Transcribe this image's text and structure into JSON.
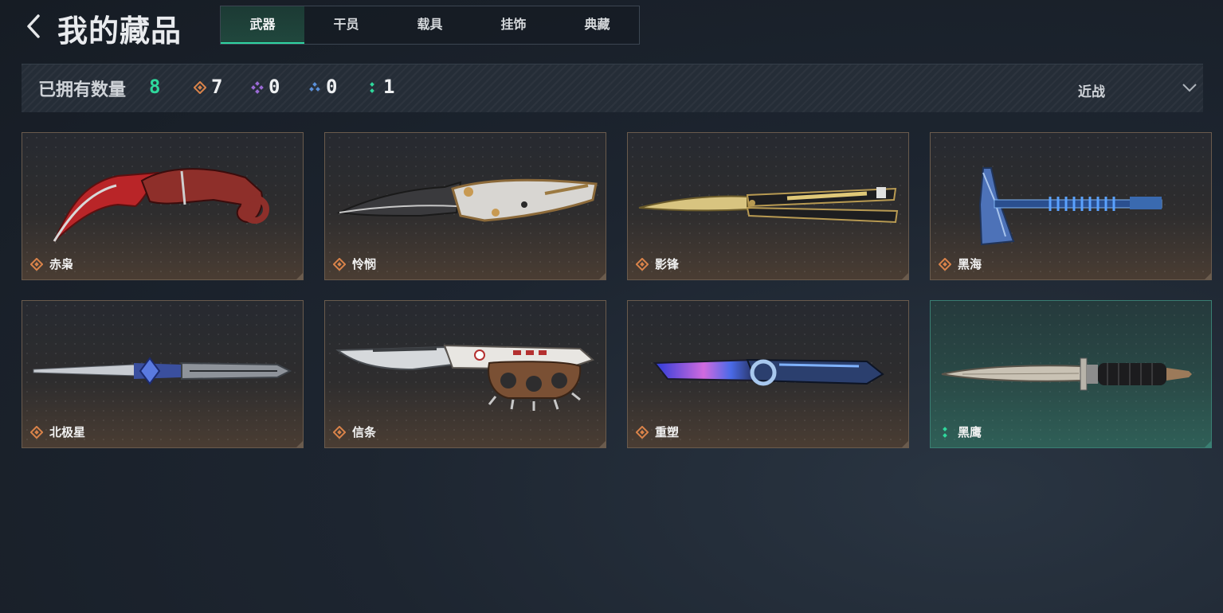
{
  "header": {
    "title": "我的藏品",
    "tabs": [
      {
        "label": "武器",
        "active": true
      },
      {
        "label": "干员",
        "active": false
      },
      {
        "label": "载具",
        "active": false
      },
      {
        "label": "挂饰",
        "active": false
      },
      {
        "label": "典藏",
        "active": false
      }
    ]
  },
  "summary": {
    "owned_label": "已拥有数量",
    "owned_count": "8",
    "rarity_counts": [
      {
        "icon": "orange-diamond-icon",
        "color": "#d9834a",
        "value": "7"
      },
      {
        "icon": "purple-diamond-icon",
        "color": "#9b6bd6",
        "value": "0"
      },
      {
        "icon": "blue-triangle-icon",
        "color": "#5b8fd8",
        "value": "0"
      },
      {
        "icon": "green-dots-icon",
        "color": "#2fd89c",
        "value": "1"
      }
    ],
    "filter": {
      "selected": "近战"
    }
  },
  "items": [
    {
      "name": "赤枭",
      "rarity": "orange"
    },
    {
      "name": "怜悯",
      "rarity": "orange"
    },
    {
      "name": "影锋",
      "rarity": "orange"
    },
    {
      "name": "黑海",
      "rarity": "orange"
    },
    {
      "name": "北极星",
      "rarity": "orange"
    },
    {
      "name": "信条",
      "rarity": "orange"
    },
    {
      "name": "重塑",
      "rarity": "orange"
    },
    {
      "name": "黑鹰",
      "rarity": "green"
    }
  ],
  "colors": {
    "accent": "#2fd89c",
    "orange_rarity": "#d9834a",
    "card_border": "#6a5b4d",
    "card_border_teal": "#3a7f73"
  }
}
